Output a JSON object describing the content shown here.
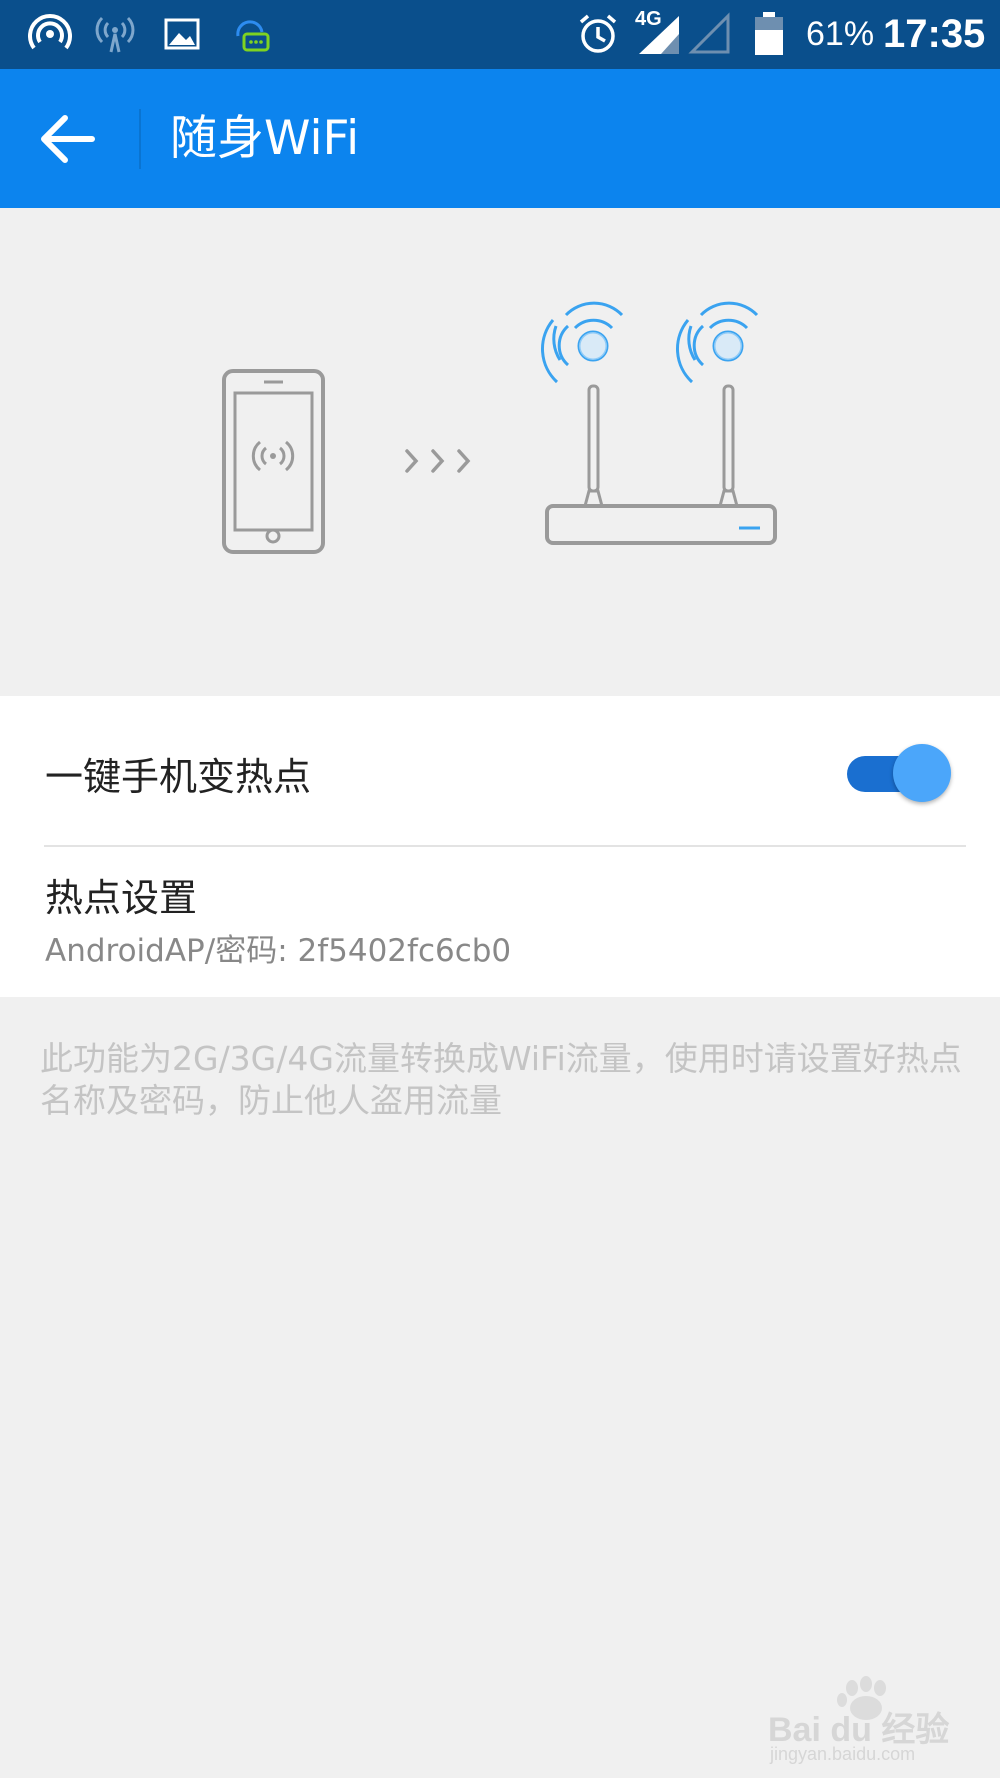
{
  "status_bar": {
    "battery_percent": "61%",
    "time": "17:35",
    "network_label": "4G",
    "icons": [
      "hotspot-icon",
      "wifi-tethering-icon",
      "image-icon",
      "chat-assistant-icon",
      "alarm-icon",
      "signal-4g-icon",
      "signal-empty-icon",
      "battery-icon"
    ]
  },
  "appbar": {
    "title": "随身WiFi",
    "back_icon": "arrow-left-icon"
  },
  "colors": {
    "appbar": "#0c84ee",
    "statusbar": "#0a4f8c",
    "accent": "#4ba6fa",
    "toggle_track": "#1a6fd0"
  },
  "settings": {
    "hotspot_toggle": {
      "label": "一键手机变热点",
      "checked": true
    },
    "hotspot_settings": {
      "label": "热点设置",
      "subtitle": "AndroidAP/密码: 2f5402fc6cb0"
    }
  },
  "note": "此功能为2G/3G/4G流量转换成WiFi流量，使用时请设置好热点名称及密码，防止他人盗用流量",
  "watermark": {
    "brand": "Bai du 经验",
    "url": "jingyan.baidu.com"
  }
}
